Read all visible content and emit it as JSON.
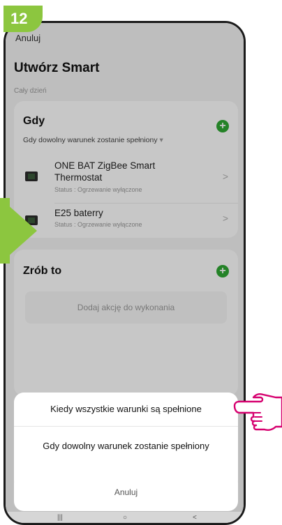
{
  "badge": {
    "step": "12"
  },
  "header": {
    "cancel_label": "Anuluj",
    "title": "Utwórz Smart",
    "subtitle": "Cały dzień"
  },
  "gdy_card": {
    "title": "Gdy",
    "condition_label": "Gdy dowolny warunek zostanie spełniony",
    "condition_chevron": "▾",
    "devices": [
      {
        "name_line1": "ONE BAT ZigBee Smart",
        "name_line2": "Thermostat",
        "status": "Status : Ogrzewanie wyłączone"
      },
      {
        "name_line1": "E25 baterry",
        "name_line2": "",
        "status": "Status : Ogrzewanie wyłączone"
      }
    ]
  },
  "zrob_card": {
    "title": "Zrób to",
    "placeholder": "Dodaj akcję do wykonania"
  },
  "action_sheet": {
    "options": [
      "Kiedy wszystkie warunki są spełnione",
      "Gdy dowolny warunek zostanie spełniony"
    ],
    "cancel_label": "Anuluj"
  },
  "nav": {
    "recent": "|||",
    "home": "○",
    "back": "<"
  },
  "icons": {
    "add": "plus-icon",
    "chevron": "chevron-right-icon",
    "device": "thermostat-icon",
    "pointer": "pointing-hand-icon"
  },
  "colors": {
    "accent_green": "#8cc63f",
    "button_green": "#2fa733",
    "hand_outline": "#d6006f"
  }
}
